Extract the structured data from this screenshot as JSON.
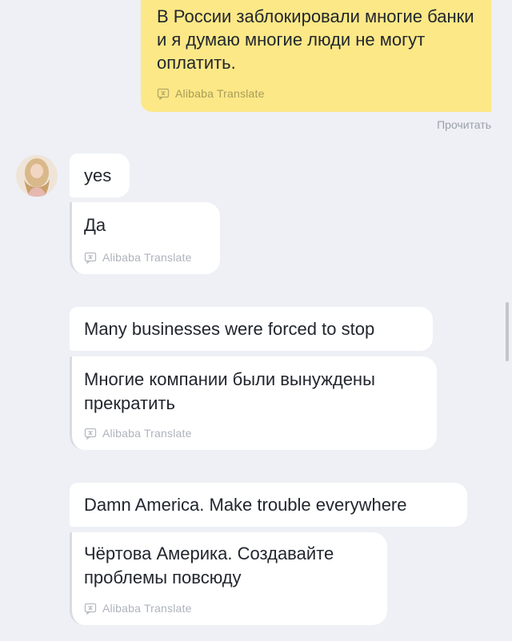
{
  "outgoing": {
    "text": "В России заблокировали многие банки и я думаю многие люди не могут оплатить.",
    "translate_label": "Alibaba Translate",
    "status": "Прочитать"
  },
  "incoming": [
    {
      "original": "yes",
      "translation": "Да",
      "translate_label": "Alibaba Translate"
    },
    {
      "original": "Many businesses were forced to stop",
      "translation": "Многие компании были вынуждены прекратить",
      "translate_label": "Alibaba Translate"
    },
    {
      "original": "Damn America. Make trouble everywhere",
      "translation": "Чёртова Америка. Создавайте проблемы повсюду",
      "translate_label": "Alibaba Translate"
    }
  ],
  "icons": {
    "translate": "translate-icon",
    "avatar": "avatar"
  },
  "colors": {
    "background": "#eef0f5",
    "outgoing_bubble": "#fce886",
    "incoming_bubble": "#ffffff",
    "muted_text": "#aeb3bc"
  }
}
